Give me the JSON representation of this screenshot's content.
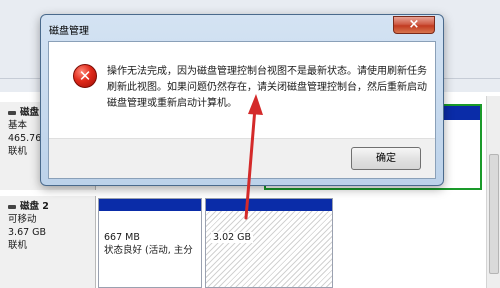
{
  "dialog": {
    "title": "磁盘管理",
    "close_label": "×",
    "icon": "error-icon",
    "message": "操作无法完成，因为磁盘管理控制台视图不是最新状态。请使用刷新任务刷新此视图。如果问题仍然存在，请关闭磁盘管理控制台，然后重新启动磁盘管理或重新启动计算机。",
    "ok_label": "确定"
  },
  "disks": [
    {
      "name": "磁盘",
      "type": "基本",
      "size": "465.76",
      "status": "联机"
    },
    {
      "name": "磁盘 2",
      "type": "可移动",
      "size": "3.67 GB",
      "status": "联机"
    }
  ],
  "partitions": [
    {
      "size": "667 MB",
      "status": "状态良好 (活动, 主分"
    },
    {
      "size": "3.02 GB"
    }
  ],
  "colors": {
    "partition_bar": "#0a2ca8",
    "selection_frame": "#1a9a2a",
    "arrow": "#d42a2a",
    "error_icon": "#e0291a"
  }
}
